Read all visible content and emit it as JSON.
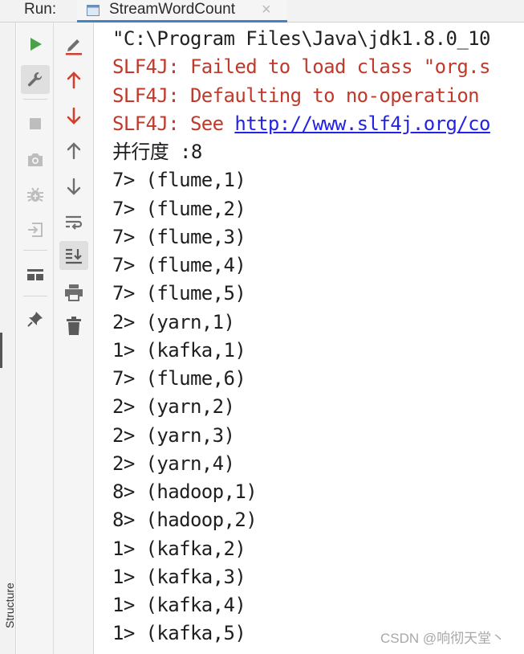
{
  "window": {
    "run_label": "Run:",
    "tab_title": "StreamWordCount",
    "tab_close": "×"
  },
  "left_stripe": {
    "structure_label": "Structure"
  },
  "toolbar_left": [
    {
      "name": "rerun-button",
      "icon": "play-icon"
    },
    {
      "name": "settings-button",
      "icon": "wrench-icon"
    },
    {
      "name": "stop-button",
      "icon": "stop-icon"
    },
    {
      "name": "screenshot-button",
      "icon": "camera-icon"
    },
    {
      "name": "debug-button",
      "icon": "bug-icon"
    },
    {
      "name": "login-button",
      "icon": "login-icon"
    },
    {
      "name": "layout-button",
      "icon": "layout-icon"
    },
    {
      "name": "pin-button",
      "icon": "pin-icon"
    }
  ],
  "toolbar_right": [
    {
      "name": "edit-config-button",
      "icon": "edit-icon"
    },
    {
      "name": "prev-error-button",
      "icon": "arrow-up-red-icon"
    },
    {
      "name": "next-error-button",
      "icon": "arrow-down-red-icon"
    },
    {
      "name": "scroll-up-button",
      "icon": "arrow-up-icon"
    },
    {
      "name": "scroll-down-button",
      "icon": "arrow-down-icon"
    },
    {
      "name": "soft-wrap-button",
      "icon": "soft-wrap-icon"
    },
    {
      "name": "scroll-to-end-button",
      "icon": "scroll-to-end-icon"
    },
    {
      "name": "print-button",
      "icon": "print-icon"
    },
    {
      "name": "clear-button",
      "icon": "trash-icon"
    }
  ],
  "colors": {
    "error_text": "#c0392b",
    "link": "#2323e6",
    "accent_tab": "#4083c9",
    "play_green": "#4aa14a",
    "icon_gray": "#6e6e6e",
    "icon_red": "#d0412f"
  },
  "console": {
    "lines": [
      {
        "type": "cmd",
        "text": "\"C:\\Program Files\\Java\\jdk1.8.0_10"
      },
      {
        "type": "err",
        "text": "SLF4J: Failed to load class \"org.s"
      },
      {
        "type": "err",
        "text": "SLF4J: Defaulting to no-operation"
      },
      {
        "type": "err",
        "text": "SLF4J: See ",
        "link": "http://www.slf4j.org/co"
      },
      {
        "type": "out",
        "text": "并行度 :8"
      },
      {
        "type": "out",
        "text": "7> (flume,1)"
      },
      {
        "type": "out",
        "text": "7> (flume,2)"
      },
      {
        "type": "out",
        "text": "7> (flume,3)"
      },
      {
        "type": "out",
        "text": "7> (flume,4)"
      },
      {
        "type": "out",
        "text": "7> (flume,5)"
      },
      {
        "type": "out",
        "text": "2> (yarn,1)"
      },
      {
        "type": "out",
        "text": "1> (kafka,1)"
      },
      {
        "type": "out",
        "text": "7> (flume,6)"
      },
      {
        "type": "out",
        "text": "2> (yarn,2)"
      },
      {
        "type": "out",
        "text": "2> (yarn,3)"
      },
      {
        "type": "out",
        "text": "2> (yarn,4)"
      },
      {
        "type": "out",
        "text": "8> (hadoop,1)"
      },
      {
        "type": "out",
        "text": "8> (hadoop,2)"
      },
      {
        "type": "out",
        "text": "1> (kafka,2)"
      },
      {
        "type": "out",
        "text": "1> (kafka,3)"
      },
      {
        "type": "out",
        "text": "1> (kafka,4)"
      },
      {
        "type": "out",
        "text": "1> (kafka,5)"
      }
    ]
  },
  "watermark": "CSDN @响彻天堂丶"
}
